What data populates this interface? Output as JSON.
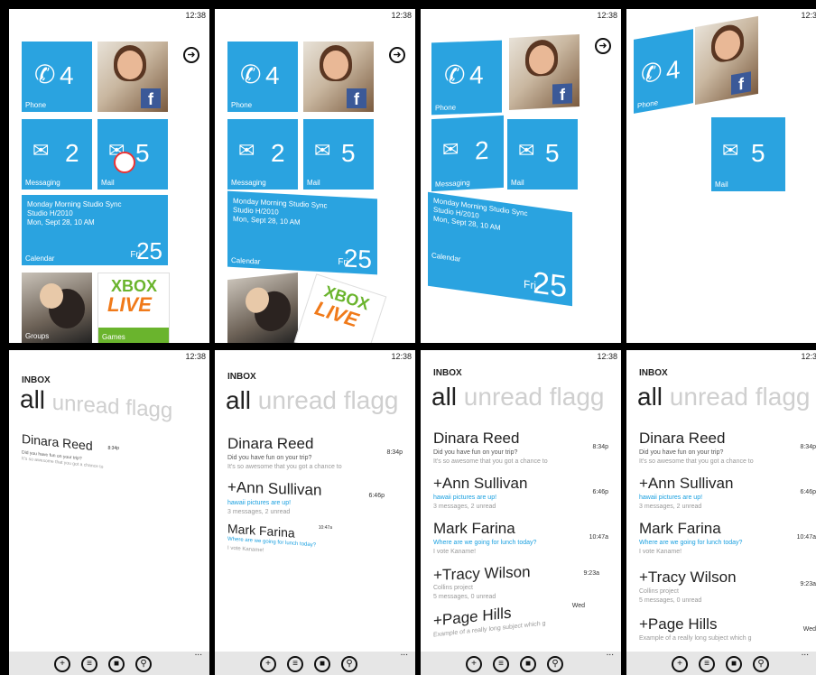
{
  "clock": "12:38",
  "tiles": {
    "phone": {
      "label": "Phone",
      "count": "4"
    },
    "messaging": {
      "label": "Messaging",
      "count": "2"
    },
    "mail": {
      "label": "Mail",
      "count": "5"
    },
    "calendar": {
      "label": "Calendar",
      "line1": "Monday Morning Studio Sync",
      "line2": "Studio H/2010",
      "line3": "Mon, Sept 28, 10 AM",
      "day": "Fri",
      "date": "25"
    },
    "groups": {
      "label": "Groups"
    },
    "games": {
      "label": "Games",
      "xbox": "XBOX",
      "live": "LIVE"
    }
  },
  "inbox": {
    "title": "INBOX",
    "pivot_all": "all",
    "pivot_rest": "unread flagg",
    "messages": [
      {
        "name": "Dinara Reed",
        "line1": "Did you have fun on your trip?",
        "line2": "It's so awesome that you got a chance to",
        "time": "8:34p"
      },
      {
        "name": "+Ann Sullivan",
        "line1": "hawaii pictures are up!",
        "line2": "3 messages, 2 unread",
        "time": "6:46p"
      },
      {
        "name": "Mark Farina",
        "line1": "Where are we going for lunch today?",
        "line2": "I vote Kaname!",
        "time": "10:47a"
      },
      {
        "name": "+Tracy Wilson",
        "line1": "Collins project",
        "line2": "5 messages, 0 unread",
        "time": "9:23a"
      },
      {
        "name": "+Page Hills",
        "line1": "Example of a really long subject which g",
        "line2": "",
        "time": "Wed"
      }
    ]
  },
  "appbar": {
    "new_icon": "plus-icon",
    "list_icon": "list-icon",
    "folder_icon": "folder-icon",
    "search_icon": "search-icon",
    "more": "..."
  },
  "colors": {
    "tile": "#2aa3e0",
    "facebook": "#3b5998",
    "link": "#1aa0e0"
  }
}
